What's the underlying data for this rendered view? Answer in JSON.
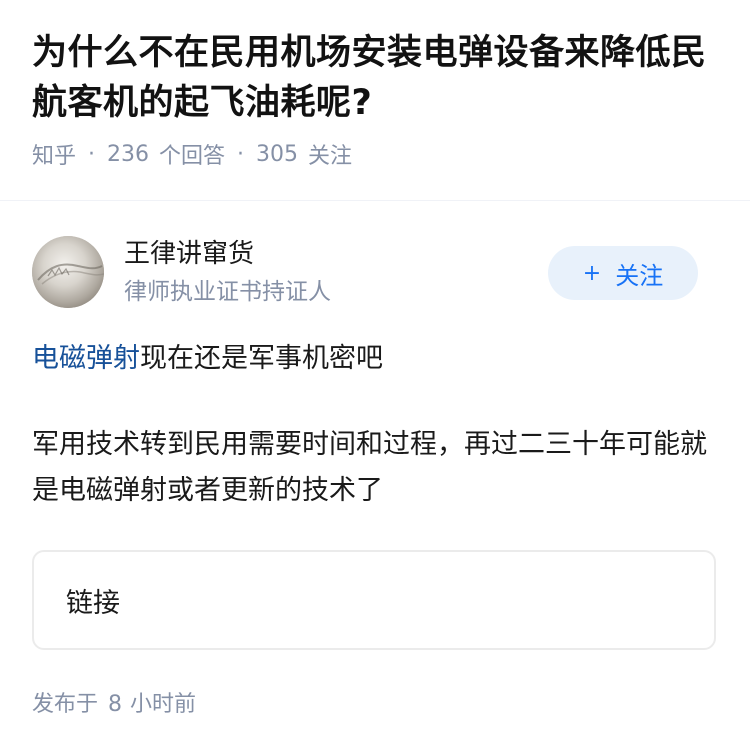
{
  "question": {
    "title": "为什么不在民用机场安装电弹设备来降低民航客机的起飞油耗呢?",
    "source": "知乎",
    "answers_count": "236",
    "answers_label": "个回答",
    "followers_count": "305",
    "followers_label": "关注",
    "separator": "·"
  },
  "author": {
    "name": "王律讲窜货",
    "bio": "律师执业证书持证人",
    "avatar_icon": "avatar-image",
    "follow_button": {
      "plus": "+",
      "label": "关注"
    }
  },
  "answer": {
    "p1_link": "电磁弹射",
    "p1_rest": "现在还是军事机密吧",
    "p2": "军用技术转到民用需要时间和过程，再过二三十年可能就是电磁弹射或者更新的技术了"
  },
  "link_card": {
    "label": "链接"
  },
  "posted": {
    "prefix": "发布于",
    "number": "8",
    "suffix": "小时前"
  },
  "colors": {
    "accent": "#1772f6",
    "link": "#175199",
    "muted": "#8590a6",
    "follow_bg": "#e8f1fb"
  }
}
